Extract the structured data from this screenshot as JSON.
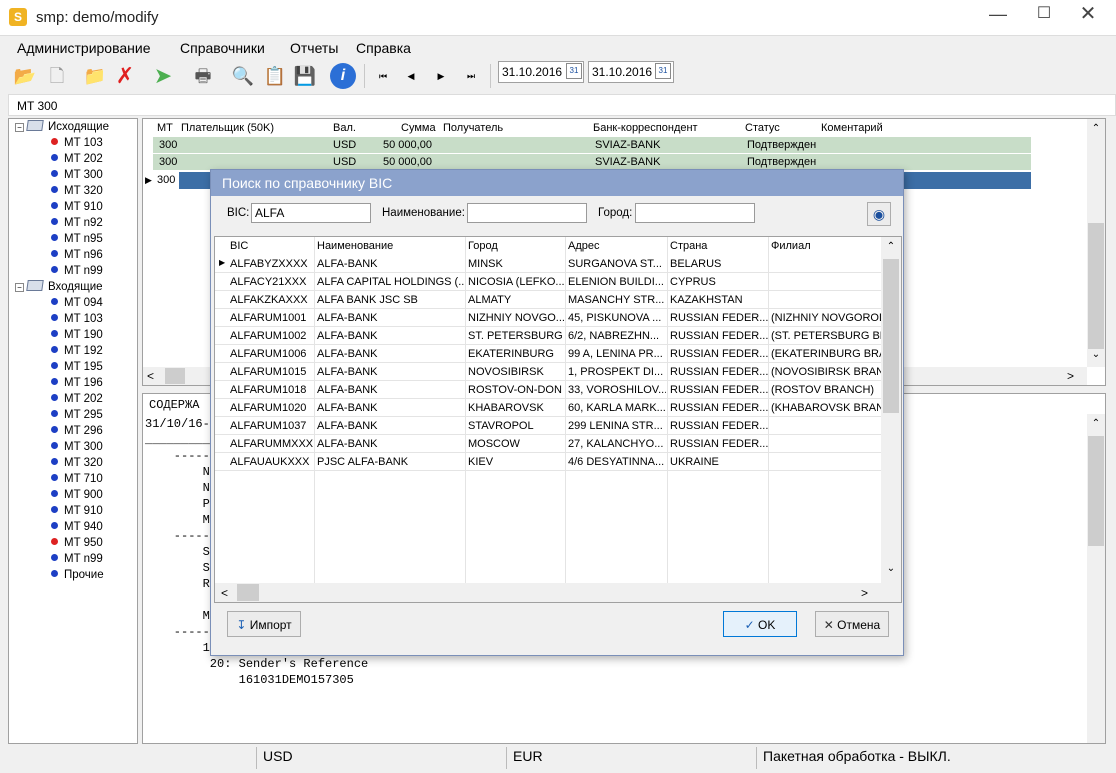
{
  "window": {
    "title": "smp: demo/modify",
    "icon_letter": "S"
  },
  "menu": [
    "Администрирование",
    "Справочники",
    "Отчеты",
    "Справка"
  ],
  "toolbar": {
    "date_from": "31.10.2016",
    "date_to": "31.10.2016",
    "cal": "31"
  },
  "breadcrumb": "MT 300",
  "tree": {
    "outgoing": {
      "label": "Исходящие",
      "items": [
        {
          "label": "MT 103",
          "status": "red"
        },
        {
          "label": "MT 202"
        },
        {
          "label": "MT 300"
        },
        {
          "label": "MT 320"
        },
        {
          "label": "MT 910"
        },
        {
          "label": "MT n92"
        },
        {
          "label": "MT n95"
        },
        {
          "label": "MT n96"
        },
        {
          "label": "MT n99"
        }
      ]
    },
    "incoming": {
      "label": "Входящие",
      "items": [
        {
          "label": "MT 094"
        },
        {
          "label": "MT 103"
        },
        {
          "label": "MT 190"
        },
        {
          "label": "MT 192"
        },
        {
          "label": "MT 195"
        },
        {
          "label": "MT 196"
        },
        {
          "label": "MT 202"
        },
        {
          "label": "MT 295"
        },
        {
          "label": "MT 296"
        },
        {
          "label": "MT 300"
        },
        {
          "label": "MT 320"
        },
        {
          "label": "MT 710"
        },
        {
          "label": "MT 900"
        },
        {
          "label": "MT 910"
        },
        {
          "label": "MT 940"
        },
        {
          "label": "MT 950",
          "status": "red"
        },
        {
          "label": "MT n99"
        },
        {
          "label": "Прочие"
        }
      ]
    }
  },
  "grid": {
    "columns": [
      "MT",
      "Плательщик (50K)",
      "Вал.",
      "Сумма",
      "Получатель",
      "Банк-корреспондент",
      "Статус",
      "Коментарий"
    ],
    "rows": [
      {
        "mt": "300",
        "cur": "USD",
        "sum": "50 000,00",
        "bank": "SVIAZ-BANK",
        "status": "Подтвержден"
      },
      {
        "mt": "300",
        "cur": "USD",
        "sum": "50 000,00",
        "bank": "SVIAZ-BANK",
        "status": "Подтвержден"
      },
      {
        "mt": "300"
      }
    ]
  },
  "detail": {
    "header": "СОДЕРЖА",
    "lines": [
      "31/10/16-",
      "___________",
      "    ------",
      "        No",
      "        Ne",
      "        Pr",
      "        Me",
      "    ------",
      "        Sv",
      "        Se",
      "",
      "",
      "        Re",
      "",
      "",
      "            MOSCOW RU",
      "        MUR : 161031DEMO157305",
      "    -------------------------- Message Text ---------------------------",
      "        15A: New Sequence A",
      "         20: Sender's Reference",
      "             161031DEMO157305"
    ]
  },
  "status_bar": [
    "USD",
    "EUR",
    "Пакетная обработка - ВЫКЛ."
  ],
  "dialog": {
    "title": "Поиск по справочнику BIC",
    "bic_label": "BIC:",
    "bic_value": "ALFA",
    "name_label": "Наименование:",
    "name_value": "",
    "city_label": "Город:",
    "city_value": "",
    "columns": [
      "BIC",
      "Наименование",
      "Город",
      "Адрес",
      "Страна",
      "Филиал"
    ],
    "rows": [
      [
        "ALFABYZXXXX",
        "ALFA-BANK",
        "MINSK",
        "SURGANOVA ST...",
        "BELARUS",
        ""
      ],
      [
        "ALFACY21XXX",
        "ALFA CAPITAL HOLDINGS (...",
        "NICOSIA (LEFKO...",
        "ELENION BUILDI...",
        "CYPRUS",
        ""
      ],
      [
        "ALFAKZKAXXX",
        "ALFA BANK JSC SB",
        "ALMATY",
        "MASANCHY STR...",
        "KAZAKHSTAN",
        ""
      ],
      [
        "ALFARUM1001",
        "ALFA-BANK",
        "NIZHNIY NOVGO...",
        "45, PISKUNOVA ...",
        "RUSSIAN FEDER...",
        "(NIZHNIY NOVGOROD"
      ],
      [
        "ALFARUM1002",
        "ALFA-BANK",
        "ST. PETERSBURG",
        "6/2, NABREZHN...",
        "RUSSIAN FEDER...",
        "(ST. PETERSBURG BR"
      ],
      [
        "ALFARUM1006",
        "ALFA-BANK",
        "EKATERINBURG",
        "99 A, LENINA PR...",
        "RUSSIAN FEDER...",
        "(EKATERINBURG BRAN"
      ],
      [
        "ALFARUM1015",
        "ALFA-BANK",
        "NOVOSIBIRSK",
        "1, PROSPEKT DI...",
        "RUSSIAN FEDER...",
        "(NOVOSIBIRSK BRANC"
      ],
      [
        "ALFARUM1018",
        "ALFA-BANK",
        "ROSTOV-ON-DON",
        "33, VOROSHILOV...",
        "RUSSIAN FEDER...",
        "(ROSTOV BRANCH)"
      ],
      [
        "ALFARUM1020",
        "ALFA-BANK",
        "KHABAROVSK",
        "60, KARLA MARK...",
        "RUSSIAN FEDER...",
        "(KHABAROVSK BRANC"
      ],
      [
        "ALFARUM1037",
        "ALFA-BANK",
        "STAVROPOL",
        "299 LENINA STR...",
        "RUSSIAN FEDER...",
        ""
      ],
      [
        "ALFARUMMXXX",
        "ALFA-BANK",
        "MOSCOW",
        "27, KALANCHYO...",
        "RUSSIAN FEDER...",
        ""
      ],
      [
        "ALFAUAUKXXX",
        "PJSC ALFA-BANK",
        "KIEV",
        "4/6 DESYATINNA...",
        "UKRAINE",
        ""
      ]
    ],
    "import_label": "Импорт",
    "ok_label": "OK",
    "cancel_label": "Отмена"
  }
}
